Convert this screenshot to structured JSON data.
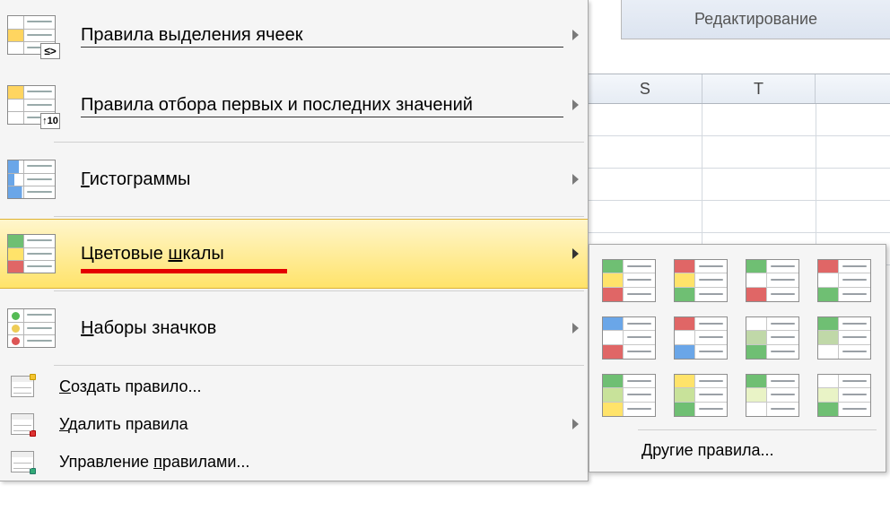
{
  "ribbon_group_label": "Редактирование",
  "columns": [
    "S",
    "T"
  ],
  "menu": {
    "highlight_cells": {
      "label": "Правила выделения ячеек",
      "glyph": "≤>"
    },
    "top_bottom": {
      "label": "Правила отбора первых и последних значений",
      "glyph": "↑10"
    },
    "data_bars": {
      "label": "Гистограммы"
    },
    "color_scales": {
      "label": "Цветовые шкалы"
    },
    "icon_sets": {
      "label": "Наборы значков"
    },
    "new_rule": {
      "label": "Создать правило..."
    },
    "clear_rules": {
      "label": "Удалить правила"
    },
    "manage_rules": {
      "label": "Управление правилами..."
    }
  },
  "flyout": {
    "more_rules": "Другие правила...",
    "swatches": [
      {
        "c": [
          "#6fbf73",
          "#ffe36a",
          "#e06666"
        ]
      },
      {
        "c": [
          "#e06666",
          "#ffe36a",
          "#6fbf73"
        ]
      },
      {
        "c": [
          "#6fbf73",
          "#ffffff",
          "#e06666"
        ]
      },
      {
        "c": [
          "#e06666",
          "#ffffff",
          "#6fbf73"
        ]
      },
      {
        "c": [
          "#6aa6e8",
          "#ffffff",
          "#e06666"
        ]
      },
      {
        "c": [
          "#e06666",
          "#ffffff",
          "#6aa6e8"
        ]
      },
      {
        "c": [
          "#ffffff",
          "#c0d8a8",
          "#6fbf73"
        ]
      },
      {
        "c": [
          "#6fbf73",
          "#c0d8a8",
          "#ffffff"
        ]
      },
      {
        "c": [
          "#6fbf73",
          "#c8e29a",
          "#ffe36a"
        ]
      },
      {
        "c": [
          "#ffe36a",
          "#c8e29a",
          "#6fbf73"
        ]
      },
      {
        "c": [
          "#6fbf73",
          "#e9f3c6",
          "#ffffff"
        ]
      },
      {
        "c": [
          "#ffffff",
          "#e9f3c6",
          "#6fbf73"
        ]
      }
    ]
  }
}
